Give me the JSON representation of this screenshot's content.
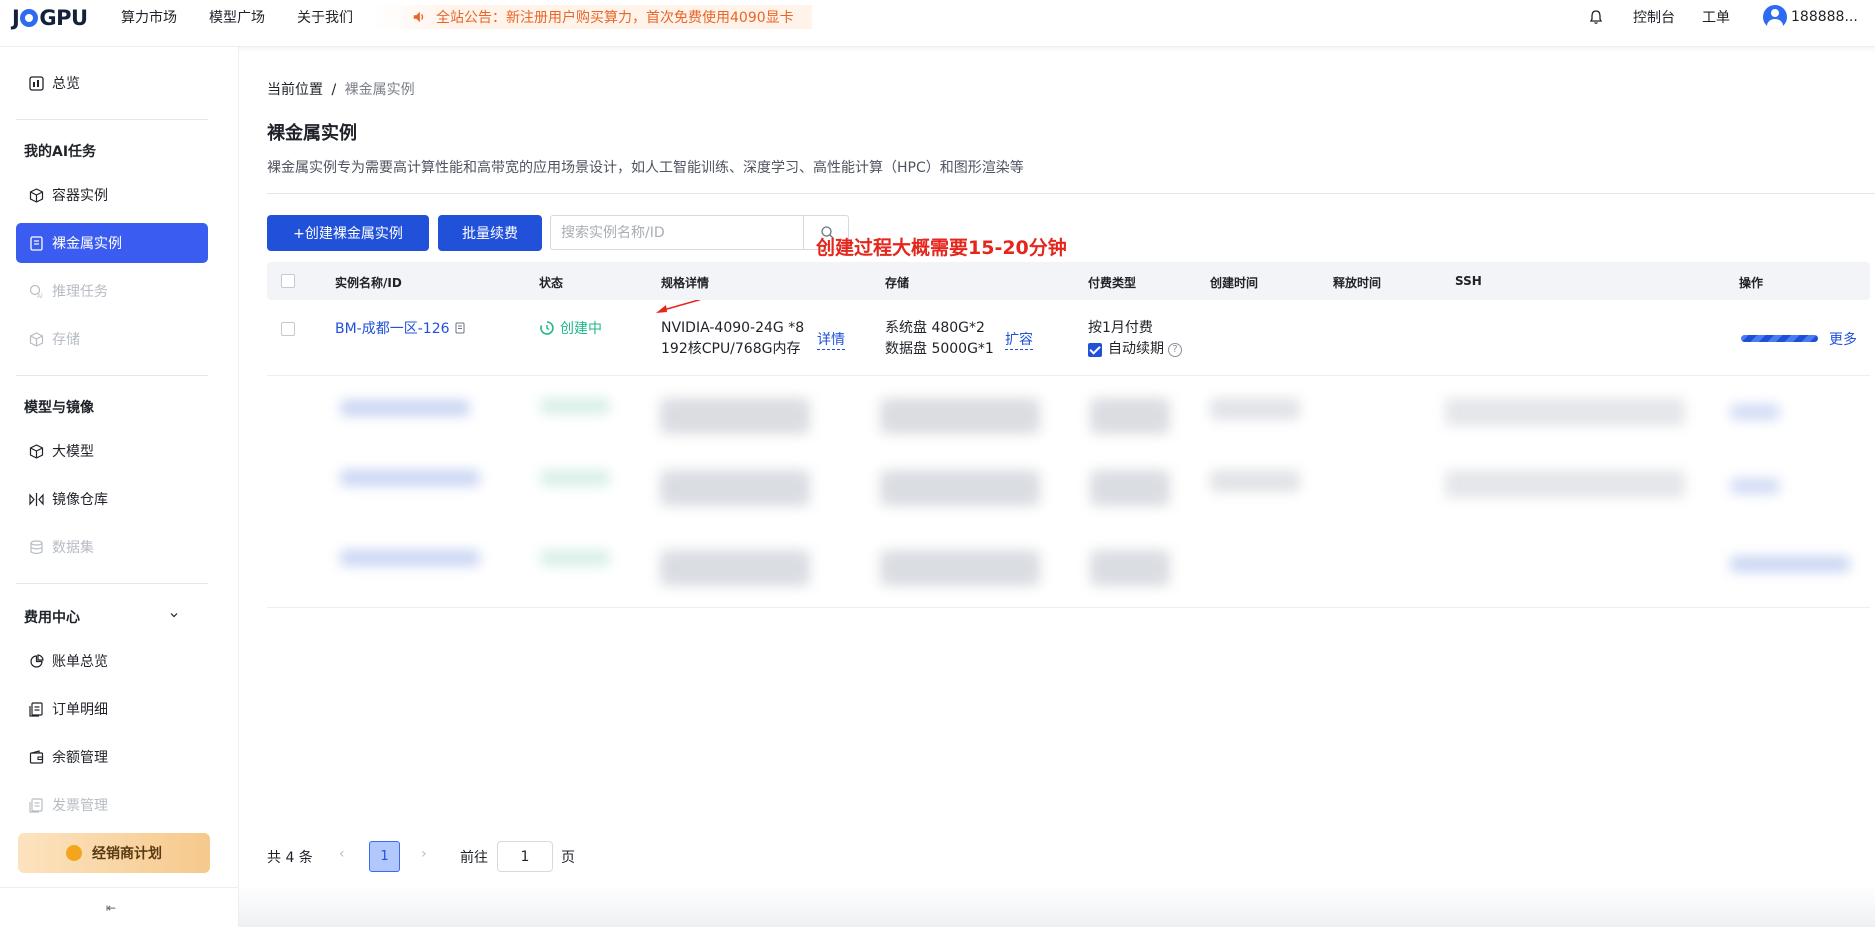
{
  "header": {
    "logo": "JYGPU",
    "nav": [
      "算力市场",
      "模型广场",
      "关于我们"
    ],
    "notice": "全站公告：新注册用户购买算力，首次免费使用4090显卡",
    "console": "控制台",
    "ticket": "工单",
    "user": "188888..."
  },
  "sidebar": {
    "overview": "总览",
    "section_ai": "我的AI任务",
    "container": "容器实例",
    "baremetal": "裸金属实例",
    "inference": "推理任务",
    "storage": "存储",
    "section_model": "模型与镜像",
    "llm": "大模型",
    "image_repo": "镜像仓库",
    "dataset": "数据集",
    "section_fee": "费用中心",
    "bill": "账单总览",
    "orders": "订单明细",
    "balance": "余额管理",
    "invoice": "发票管理",
    "promo": "经销商计划",
    "collapse": "⇤"
  },
  "breadcrumb": {
    "prefix": "当前位置",
    "sep": "/",
    "current": "裸金属实例"
  },
  "page": {
    "title": "裸金属实例",
    "description": "裸金属实例专为需要高计算性能和高带宽的应用场景设计，如人工智能训练、深度学习、高性能计算（HPC）和图形渲染等"
  },
  "toolbar": {
    "create": "+创建裸金属实例",
    "batch_renew": "批量续费",
    "search_placeholder": "搜索实例名称/ID"
  },
  "annotation": "创建过程大概需要15-20分钟",
  "table": {
    "headers": [
      "实例名称/ID",
      "状态",
      "规格详情",
      "存储",
      "付费类型",
      "创建时间",
      "释放时间",
      "SSH",
      "操作"
    ],
    "row": {
      "name": "BM-成都一区-126",
      "status": "创建中",
      "spec_line1": "NVIDIA-4090-24G *8",
      "spec_line2": "192核CPU/768G内存",
      "spec_link": "详情",
      "storage_line1": "系统盘 480G*2",
      "storage_line2": "数据盘 5000G*1",
      "storage_link": "扩容",
      "pay_type": "按1月付费",
      "auto_renew": "自动续期",
      "progress": 1.0,
      "more": "更多"
    }
  },
  "pagination": {
    "total": "共 4 条",
    "current_page": "1",
    "goto_label": "前往",
    "goto_value": "1",
    "page_suffix": "页"
  },
  "colors": {
    "primary": "#2151d9",
    "active_sidebar": "#3a5cf0",
    "status_creating": "#1fb88b",
    "annotation": "#e5261c",
    "notice": "#e8662a"
  }
}
